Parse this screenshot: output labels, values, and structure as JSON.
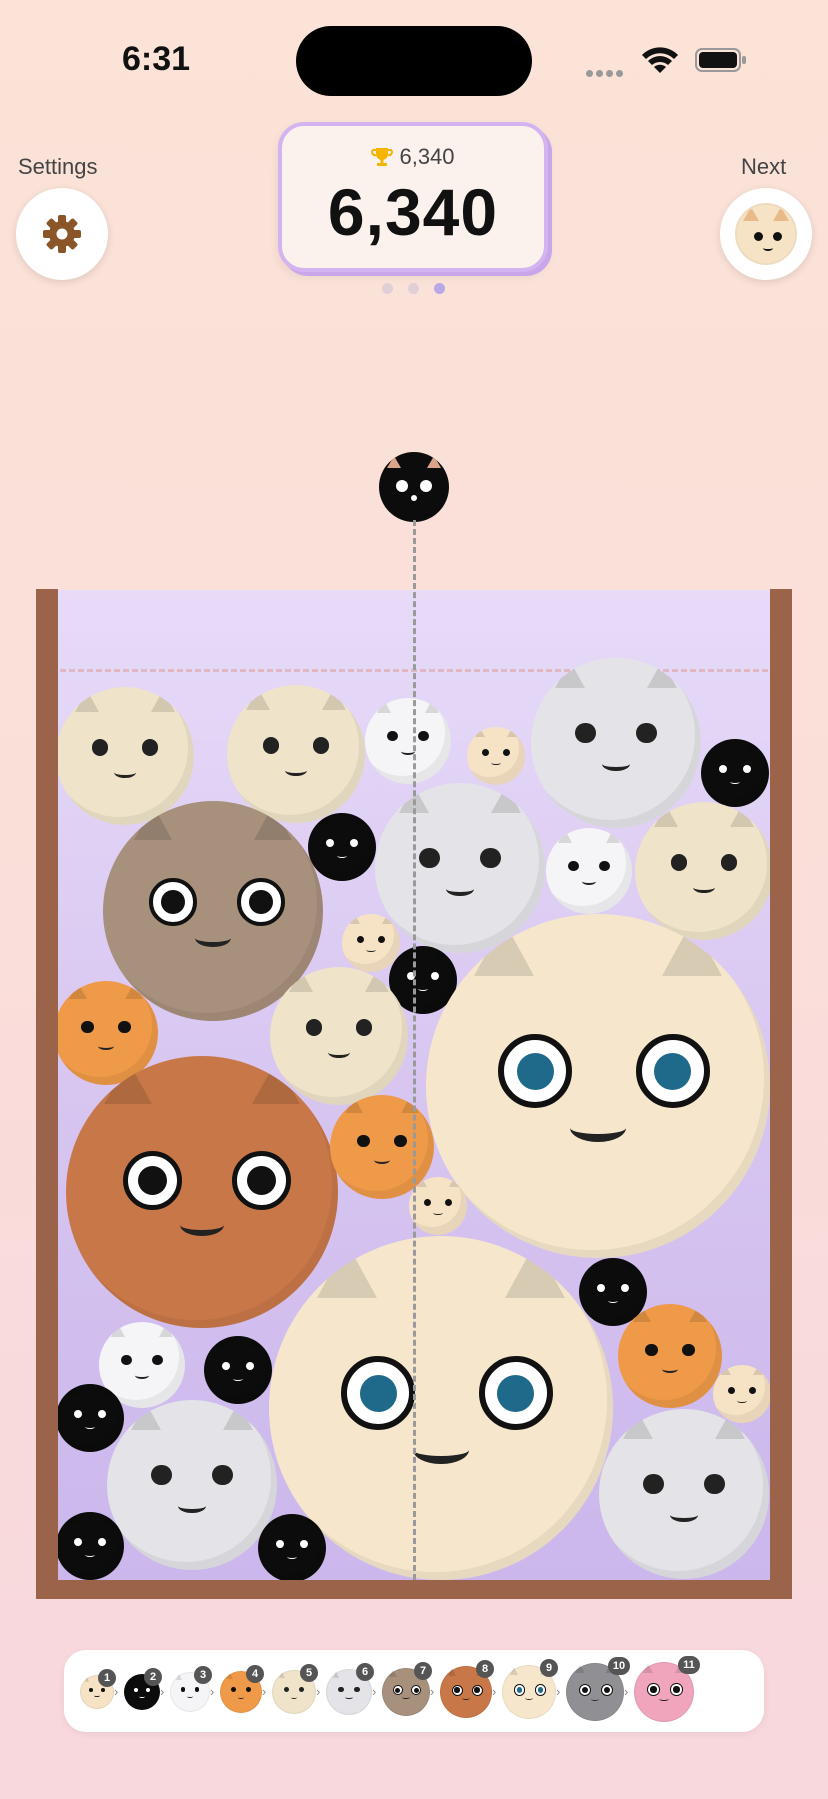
{
  "status": {
    "time": "6:31"
  },
  "top": {
    "settings_label": "Settings",
    "next_label": "Next",
    "best_score": "6,340",
    "score": "6,340",
    "page_dots_active_index": 2
  },
  "colors": {
    "wall": "#9b634a",
    "card_border": "#d4b4f0",
    "tier1": "#f6e2c5",
    "tier2": "#0c0c0c",
    "tier3": "#f5f5f7",
    "tier4": "#ef9a48",
    "tier5": "#efe4c9",
    "tier6": "#e4e4e8",
    "tier7": "#a7907c",
    "tier8": "#c87848",
    "tier9": "#f6e7cc",
    "tier10": "#8f8f94",
    "tier11": "#f0a5bc"
  },
  "current_piece": {
    "tier": 2,
    "icon": "black-cat-icon"
  },
  "next_piece": {
    "tier": 1,
    "icon": "cream-kitten-icon"
  },
  "legend": {
    "items": [
      {
        "tier": "1",
        "icon": "cream-kitten-icon"
      },
      {
        "tier": "2",
        "icon": "black-cat-icon"
      },
      {
        "tier": "3",
        "icon": "calico-cat-icon"
      },
      {
        "tier": "4",
        "icon": "orange-cat-icon"
      },
      {
        "tier": "5",
        "icon": "siamese-cat-icon"
      },
      {
        "tier": "6",
        "icon": "grey-tabby-icon"
      },
      {
        "tier": "7",
        "icon": "brown-tabby-icon"
      },
      {
        "tier": "8",
        "icon": "ginger-cat-icon"
      },
      {
        "tier": "9",
        "icon": "ragdoll-cat-icon"
      },
      {
        "tier": "10",
        "icon": "grey-cat-icon"
      },
      {
        "tier": "11",
        "icon": "pink-cat-icon"
      }
    ]
  }
}
